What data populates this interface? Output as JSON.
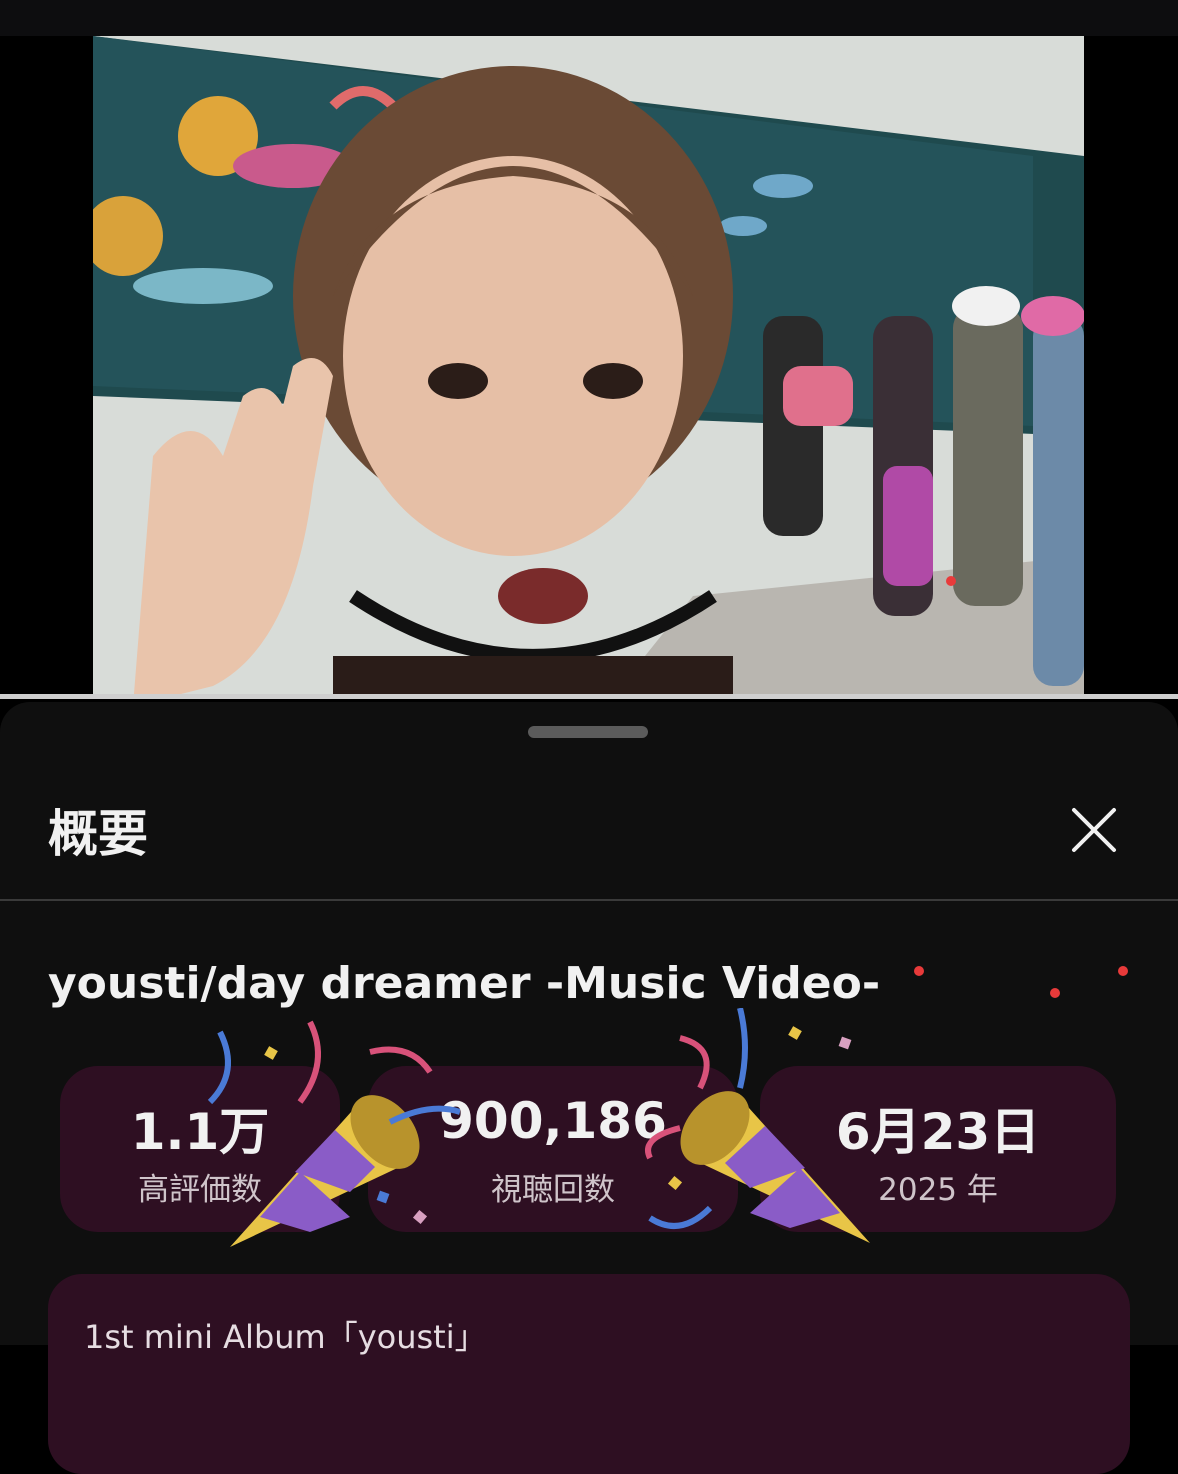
{
  "sheet": {
    "heading": "概要",
    "video_title": "yousti/day dreamer -Music Video-"
  },
  "stats": [
    {
      "value": "1.1万",
      "label": "高評価数"
    },
    {
      "value": "900,186",
      "label": "視聴回数"
    },
    {
      "value": "6月23日",
      "label": "2025 年"
    }
  ],
  "description": {
    "first_line": "1st mini Album「yousti」"
  },
  "colors": {
    "sheet_bg": "#0f0f0f",
    "card_bg": "#2e0f22",
    "accent_dot": "#e83a3a"
  },
  "icons": {
    "close": "close-icon",
    "party_popper": "party-popper-icon"
  }
}
